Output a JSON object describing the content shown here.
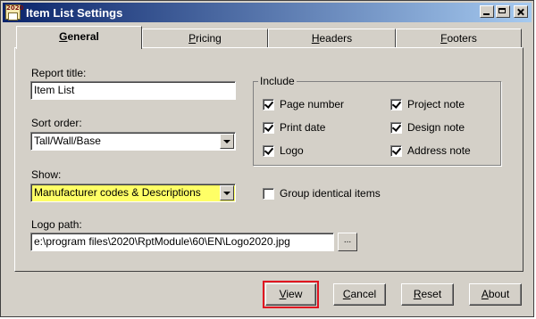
{
  "window": {
    "title": "Item List Settings",
    "icon_text": "2020"
  },
  "tabs": [
    {
      "label": "General",
      "accel": "G",
      "rest": "eneral",
      "active": true
    },
    {
      "label": "Pricing",
      "accel": "P",
      "rest": "ricing",
      "active": false
    },
    {
      "label": "Headers",
      "accel": "H",
      "rest": "eaders",
      "active": false
    },
    {
      "label": "Footers",
      "accel": "F",
      "rest": "ooters",
      "active": false
    }
  ],
  "general": {
    "report_title_label": "Report title:",
    "report_title_value": "Item List",
    "sort_order_label": "Sort order:",
    "sort_order_value": "Tall/Wall/Base",
    "show_label": "Show:",
    "show_value": "Manufacturer codes & Descriptions",
    "logo_path_label": "Logo path:",
    "logo_path_value": "e:\\program files\\2020\\RptModule\\60\\EN\\Logo2020.jpg",
    "browse_label": "..."
  },
  "include": {
    "title": "Include",
    "items": [
      {
        "label": "Page number",
        "checked": true
      },
      {
        "label": "Print date",
        "checked": true
      },
      {
        "label": "Logo",
        "checked": true
      },
      {
        "label": "Project note",
        "checked": true
      },
      {
        "label": "Design note",
        "checked": true
      },
      {
        "label": "Address note",
        "checked": true
      }
    ]
  },
  "group_identical": {
    "label": "Group identical items",
    "checked": false
  },
  "buttons": {
    "view": {
      "accel": "V",
      "rest": "iew"
    },
    "cancel": {
      "accel": "C",
      "rest": "ancel"
    },
    "reset": {
      "accel": "R",
      "rest": "eset"
    },
    "about": {
      "accel": "A",
      "rest": "bout"
    }
  },
  "colors": {
    "highlight": "#ffff66",
    "focus_ring": "#e01020",
    "titlebar": "#0a246a"
  }
}
